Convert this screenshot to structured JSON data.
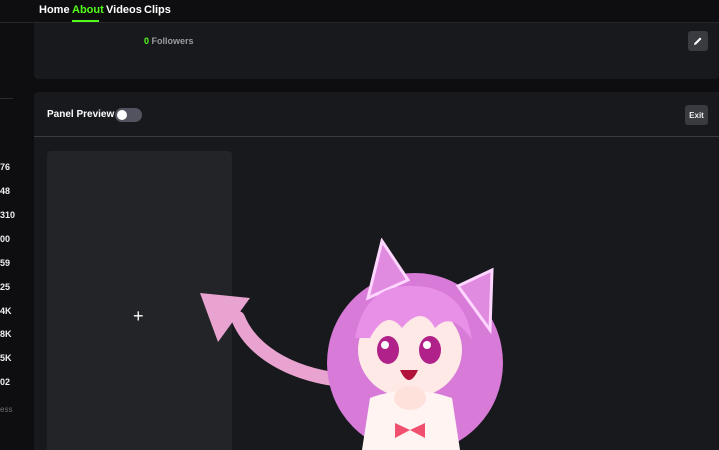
{
  "nav": {
    "tabs": [
      {
        "label": "Home",
        "active": false
      },
      {
        "label": "About",
        "active": true
      },
      {
        "label": "Videos",
        "active": false
      },
      {
        "label": "Clips",
        "active": false
      }
    ]
  },
  "sidebar": {
    "stats": [
      "76",
      "48",
      "310",
      "00",
      "59",
      "25",
      "4K",
      "8K",
      "5K",
      "02"
    ],
    "partial_word": "ess"
  },
  "profile": {
    "followers_count": "0",
    "followers_label": "Followers"
  },
  "panel_preview": {
    "title": "Panel Preview",
    "toggle_on": false,
    "exit_label": "Exit",
    "add_symbol": "+"
  },
  "icons": {
    "edit": "pencil-icon",
    "add": "plus-icon"
  },
  "colors": {
    "accent": "#53fc18",
    "background": "#0e0e10",
    "card": "#18191c",
    "add_panel": "#222427",
    "button": "#3a3b40",
    "arrow": "#e8a3d0"
  }
}
